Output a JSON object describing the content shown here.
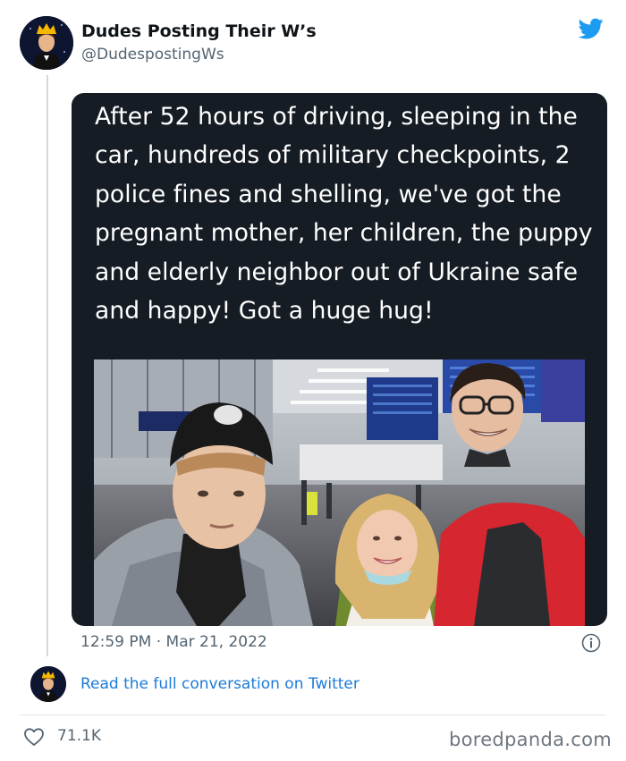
{
  "account": {
    "display_name": "Dudes Posting Their W’s",
    "handle": "@DudespostingWs",
    "avatar_icon": "crowned-man-avatar"
  },
  "header": {
    "platform_icon": "twitter-bird-icon",
    "accent_color": "#1d9bf0"
  },
  "tweet": {
    "text": "After 52 hours of driving, sleeping in the car, hundreds of military checkpoints, 2 police fines and shelling, we've got the pregnant mother, her children, the puppy and elderly neighbor out of Ukraine safe and happy! Got a huge hug!",
    "timestamp": "12:59 PM · Mar 21, 2022"
  },
  "footer": {
    "read_link": "Read the full conversation on Twitter",
    "like_count": "71.1K",
    "watermark": "boredpanda.com",
    "link_color": "#1d7bd8"
  }
}
